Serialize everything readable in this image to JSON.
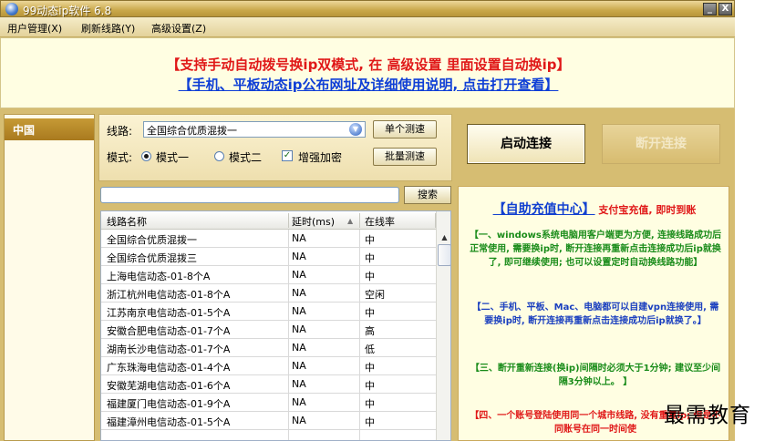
{
  "window": {
    "title": "99动态ip软件 6.8",
    "min_glyph": "_",
    "close_glyph": "X"
  },
  "menu": [
    "用户管理(X)",
    "刷新线路(Y)",
    "高级设置(Z)"
  ],
  "notice": {
    "line1": "【支持手动自动拨号换ip双模式, 在 高级设置 里面设置自动换ip】",
    "line2": "【手机、平板动态ip公布网址及详细使用说明, 点击打开查看】"
  },
  "regions": [
    "中国"
  ],
  "controls": {
    "line_label": "线路:",
    "line_value": "全国综合优质混拨一",
    "single_test": "单个测速",
    "mode_label": "模式:",
    "mode1": "模式一",
    "mode2": "模式二",
    "encrypt": "增强加密",
    "batch_test": "批量测速",
    "selected_mode": "模式一",
    "encrypt_checked": true
  },
  "search": {
    "value": "",
    "button": "搜索"
  },
  "table": {
    "headers": [
      "线路名称",
      "延时(ms)",
      "在线率"
    ],
    "sort_indicator": "▲",
    "rows": [
      [
        "全国综合优质混拨一",
        "NA",
        "中"
      ],
      [
        "全国综合优质混拨三",
        "NA",
        "中"
      ],
      [
        "上海电信动态-01-8个A",
        "NA",
        "中"
      ],
      [
        "浙江杭州电信动态-01-8个A",
        "NA",
        "空闲"
      ],
      [
        "江苏南京电信动态-01-5个A",
        "NA",
        "中"
      ],
      [
        "安徽合肥电信动态-01-7个A",
        "NA",
        "高"
      ],
      [
        "湖南长沙电信动态-01-7个A",
        "NA",
        "低"
      ],
      [
        "广东珠海电信动态-01-4个A",
        "NA",
        "中"
      ],
      [
        "安徽芜湖电信动态-01-6个A",
        "NA",
        "中"
      ],
      [
        "福建厦门电信动态-01-9个A",
        "NA",
        "中"
      ],
      [
        "福建漳州电信动态-01-5个A",
        "NA",
        "中"
      ],
      [
        "",
        "",
        ""
      ]
    ]
  },
  "actions": {
    "connect": "启动连接",
    "disconnect": "断开连接"
  },
  "info": {
    "title": "【自助充值中心】",
    "subtitle": "支付宝充值, 即时到账",
    "p1": "【一、windows系统电脑用客户端更为方便, 连接线路成功后正常使用, 需要换ip时, 断开连接再重新点击连接成功后ip就换了, 即可继续使用; 也可以设置定时自动换线路功能】",
    "p2": "【二、手机、平板、Mac、电脑都可以自建vpn连接使用, 需要换ip时, 断开连接再重新点击连接成功后ip就换了。】",
    "p3": "【三、断开重新连接(换ip)间隔时必须大于1分钟; 建议至少间隔3分钟以上。 】",
    "p4": "【四、一个账号登陆使用同一个城市线路, 没有重复ip; 但是不同账号在同一时间使"
  },
  "watermark": "最需教育"
}
